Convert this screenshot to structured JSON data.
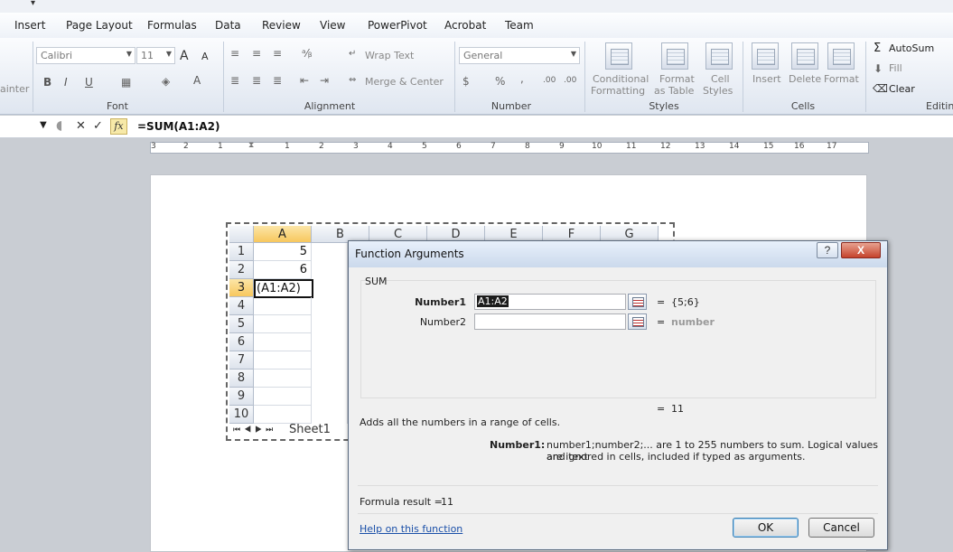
{
  "ribbon": {
    "tabs": [
      "Insert",
      "Page Layout",
      "Formulas",
      "Data",
      "Review",
      "View",
      "PowerPivot",
      "Acrobat",
      "Team"
    ],
    "clipboard_fragment": "ainter",
    "font": {
      "name": "Calibri",
      "size": "11",
      "group_label": "Font",
      "bold": "B",
      "italic": "I",
      "underline": "U",
      "grow": "A",
      "shrink": "A"
    },
    "alignment": {
      "wrap_text": "Wrap Text",
      "merge_center": "Merge & Center",
      "group_label": "Alignment"
    },
    "number": {
      "format": "General",
      "percent": "%",
      "comma": ",",
      "inc_dec": ".00",
      "dec_dec": ".00",
      "group_label": "Number"
    },
    "styles": {
      "conditional": "Conditional",
      "formatting": "Formatting",
      "format_as": "Format",
      "as_table": "as Table",
      "cell": "Cell",
      "cell_styles": "Styles",
      "group_label": "Styles"
    },
    "cells": {
      "insert": "Insert",
      "delete": "Delete",
      "format": "Format",
      "group_label": "Cells"
    },
    "editing": {
      "autosum": "AutoSum",
      "fill": "Fill",
      "clear": "Clear",
      "group_label": "Editin"
    }
  },
  "formula_bar": {
    "formula": "=SUM(A1:A2)",
    "fx": "fx"
  },
  "ruler": {
    "labels": [
      "3",
      "2",
      "1",
      "1",
      "2",
      "3",
      "4",
      "5",
      "6",
      "7",
      "8",
      "9",
      "10",
      "11",
      "12",
      "13",
      "14",
      "15",
      "16",
      "17"
    ]
  },
  "sheet": {
    "columns": [
      "A",
      "B",
      "C",
      "D",
      "E",
      "F",
      "G"
    ],
    "rows": [
      "1",
      "2",
      "3",
      "4",
      "5",
      "6",
      "7",
      "8",
      "9",
      "10"
    ],
    "cells": {
      "A1": "5",
      "A2": "6",
      "A3": "(A1:A2)"
    },
    "tab": "Sheet1"
  },
  "dialog": {
    "title": "Function Arguments",
    "help_glyph": "?",
    "close_glyph": "X",
    "function_name": "SUM",
    "args": [
      {
        "label": "Number1",
        "value": "A1:A2",
        "result": "{5;6}"
      },
      {
        "label": "Number2",
        "value": "",
        "result": "number"
      }
    ],
    "equals": "=",
    "total": "11",
    "description": "Adds all the numbers in a range of cells.",
    "arg_help_label": "Number1:",
    "arg_help_line1": "number1;number2;... are 1 to 255 numbers to sum. Logical values and text",
    "arg_help_line2": "are ignored in cells, included if typed as arguments.",
    "formula_result_label": "Formula result =",
    "formula_result": "11",
    "help_link": "Help on this function",
    "ok": "OK",
    "cancel": "Cancel"
  }
}
